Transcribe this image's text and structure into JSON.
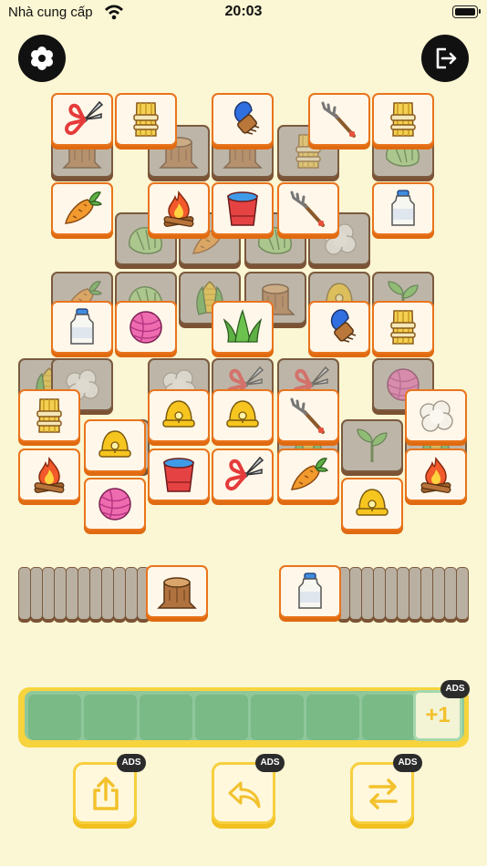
{
  "status_bar": {
    "carrier": "Nhà cung cấp",
    "time": "20:03",
    "wifi_icon": "wifi-icon",
    "battery_icon": "battery-icon"
  },
  "top_bar": {
    "settings_icon": "gear-icon",
    "exit_icon": "exit-icon"
  },
  "board": {
    "face_up_tiles": [
      "shears",
      "wheat",
      "brush",
      "rake",
      "wheat",
      "carrot",
      "campfire",
      "bucket",
      "rake",
      "milk",
      "milk",
      "yarn",
      "grass",
      "brush",
      "wheat",
      "wheat",
      "bell",
      "bell",
      "rake",
      "cotton",
      "campfire",
      "yarn",
      "bucket",
      "shears",
      "carrot",
      "bell",
      "campfire",
      "stump",
      "milk"
    ],
    "covered_tiles": [
      "stump",
      "stump",
      "stump",
      "wheat",
      "cabbage",
      "cabbage",
      "carrot",
      "cabbage",
      "cotton",
      "carrot",
      "cabbage",
      "corn",
      "stump",
      "bell",
      "sprout",
      "corn",
      "cotton",
      "cotton",
      "shears",
      "shears",
      "yarn",
      "grass",
      "corn",
      "sprout",
      "corn"
    ],
    "left_deck_count": 11,
    "right_deck_count": 11
  },
  "tray": {
    "slot_count": 7,
    "filled": 0,
    "extra_slot_label": "+1",
    "extra_slot_ad": "ADS"
  },
  "tools": [
    {
      "id": "move-out",
      "icon": "share-icon",
      "ad_label": "ADS"
    },
    {
      "id": "undo",
      "icon": "undo-icon",
      "ad_label": "ADS"
    },
    {
      "id": "shuffle",
      "icon": "shuffle-icon",
      "ad_label": "ADS"
    }
  ],
  "colors": {
    "background": "#fbf6d3",
    "tile_border": "#e9741d",
    "tray": "#f7d33e",
    "tray_slot": "#79ba86",
    "button_border": "#f7cf3e"
  }
}
